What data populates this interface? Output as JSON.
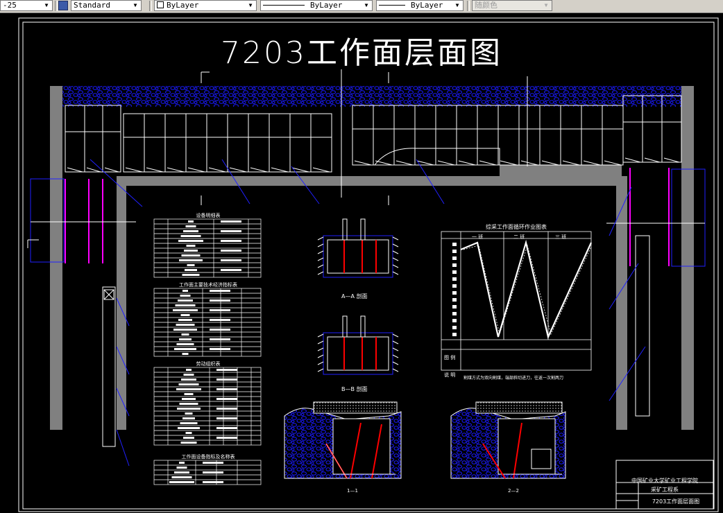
{
  "toolbar": {
    "dimstyle_value": "-25",
    "textstyle_value": "Standard",
    "layer_value": "ByLayer",
    "linetype_value": "ByLayer",
    "lineweight_value": "ByLayer",
    "plotstyle_value": "随颜色"
  },
  "drawing": {
    "title": "7203工作面层面图",
    "section_aa": "A—A 剖面",
    "section_bb": "B—B 剖面",
    "table1_title": "设备明细表",
    "table2_title": "工作面主要技术经济指标表",
    "table3_title": "劳动组织表",
    "table4_title": "工作面设备指标及名称表",
    "cycle_chart_title": "综采工作面循环作业图表",
    "cycle_chart_header": [
      "一  班",
      "二  班",
      "三  班"
    ],
    "cycle_chart_row1": "图  例",
    "cycle_chart_row2": "说  明",
    "cycle_chart_note": "割煤方式为双向割煤，端部斜切进刀，往返一次割两刀",
    "section_11": "1—1",
    "section_22": "2—2",
    "titleblock": {
      "school": "中国矿业大学矿业工程学院",
      "dept": "采矿工程系",
      "drawing_name": "7203工作面层面图"
    }
  },
  "colors": {
    "toolbar_bg": "#d4d0c8",
    "canvas_bg": "#000000",
    "pillar_gray": "#808080",
    "rock_blue": "#1a1aff",
    "magenta": "#ff00ff",
    "red": "#ff0000"
  }
}
